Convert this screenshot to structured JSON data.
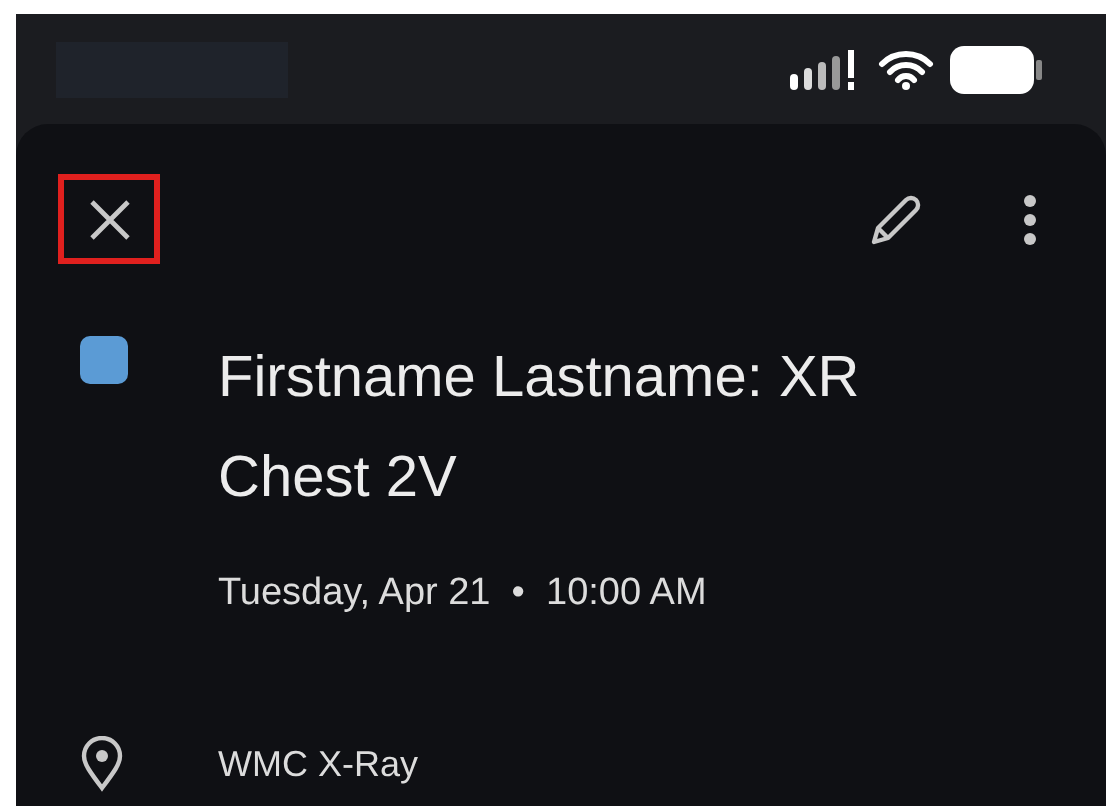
{
  "event": {
    "title": "Firstname Lastname: XR Chest 2V",
    "color": "#5b9bd5",
    "when": "Tuesday, Apr 21  •  10:00 AM",
    "location": "WMC X-Ray"
  },
  "close_highlighted": true
}
